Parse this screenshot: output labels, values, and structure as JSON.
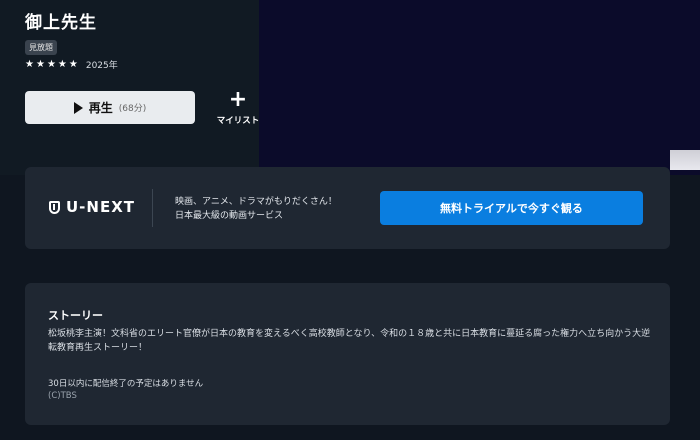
{
  "title": "御上先生",
  "badge": "見放題",
  "rating": {
    "stars": 5,
    "year": "2025年"
  },
  "play": {
    "label": "再生",
    "duration": "(68分)"
  },
  "mylist": {
    "icon": "+",
    "label": "マイリスト"
  },
  "promo": {
    "logo_text": "U-NEXT",
    "line1": "映画、アニメ、ドラマがもりだくさん！",
    "line2": "日本最大級の動画サービス",
    "trial_button": "無料トライアルで今すぐ観る",
    "accent_color": "#0a7ee0"
  },
  "story": {
    "heading": "ストーリー",
    "body": "松坂桃李主演！文科省のエリート官僚が日本の教育を変えるべく高校教師となり、令和の１８歳と共に日本教育に蔓延る腐った権力へ立ち向かう大逆転教育再生ストーリー！",
    "availability": "30日以内に配信終了の予定はありません",
    "copyright": "(C)TBS"
  }
}
